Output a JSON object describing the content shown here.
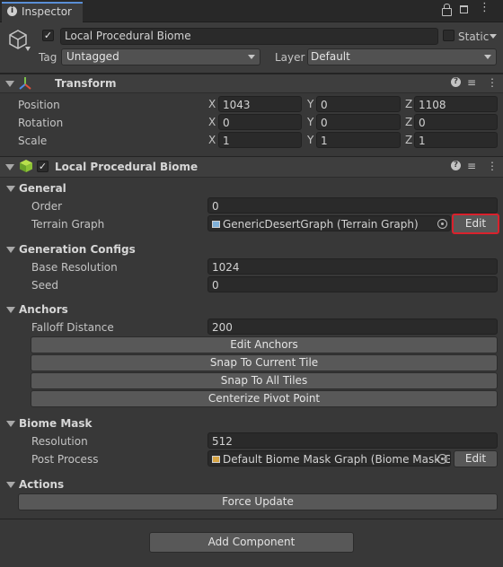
{
  "tab": {
    "title": "Inspector"
  },
  "object": {
    "name": "Local Procedural Biome",
    "static_label": "Static",
    "tag_label": "Tag",
    "tag_value": "Untagged",
    "layer_label": "Layer",
    "layer_value": "Default"
  },
  "transform": {
    "title": "Transform",
    "rows": [
      {
        "label": "Position",
        "x": "1043",
        "y": "0",
        "z": "1108"
      },
      {
        "label": "Rotation",
        "x": "0",
        "y": "0",
        "z": "0"
      },
      {
        "label": "Scale",
        "x": "1",
        "y": "1",
        "z": "1"
      }
    ],
    "axis": {
      "x": "X",
      "y": "Y",
      "z": "Z"
    }
  },
  "component": {
    "title": "Local Procedural Biome",
    "general": {
      "header": "General",
      "order_label": "Order",
      "order_value": "0",
      "graph_label": "Terrain Graph",
      "graph_value": "GenericDesertGraph (Terrain Graph)",
      "edit_label": "Edit"
    },
    "generation": {
      "header": "Generation Configs",
      "base_res_label": "Base Resolution",
      "base_res_value": "1024",
      "seed_label": "Seed",
      "seed_value": "0"
    },
    "anchors": {
      "header": "Anchors",
      "falloff_label": "Falloff Distance",
      "falloff_value": "200",
      "buttons": [
        "Edit Anchors",
        "Snap To Current Tile",
        "Snap To All Tiles",
        "Centerize Pivot Point"
      ]
    },
    "biome_mask": {
      "header": "Biome Mask",
      "resolution_label": "Resolution",
      "resolution_value": "512",
      "post_label": "Post Process",
      "post_value": "Default Biome Mask Graph (Biome Mask G",
      "edit_label": "Edit"
    },
    "actions": {
      "header": "Actions",
      "force_update_label": "Force Update"
    }
  },
  "add_component_label": "Add Component",
  "colors": {
    "highlight": "#d9212c",
    "background": "#383838",
    "field": "#2a2a2a",
    "button": "#585858"
  }
}
